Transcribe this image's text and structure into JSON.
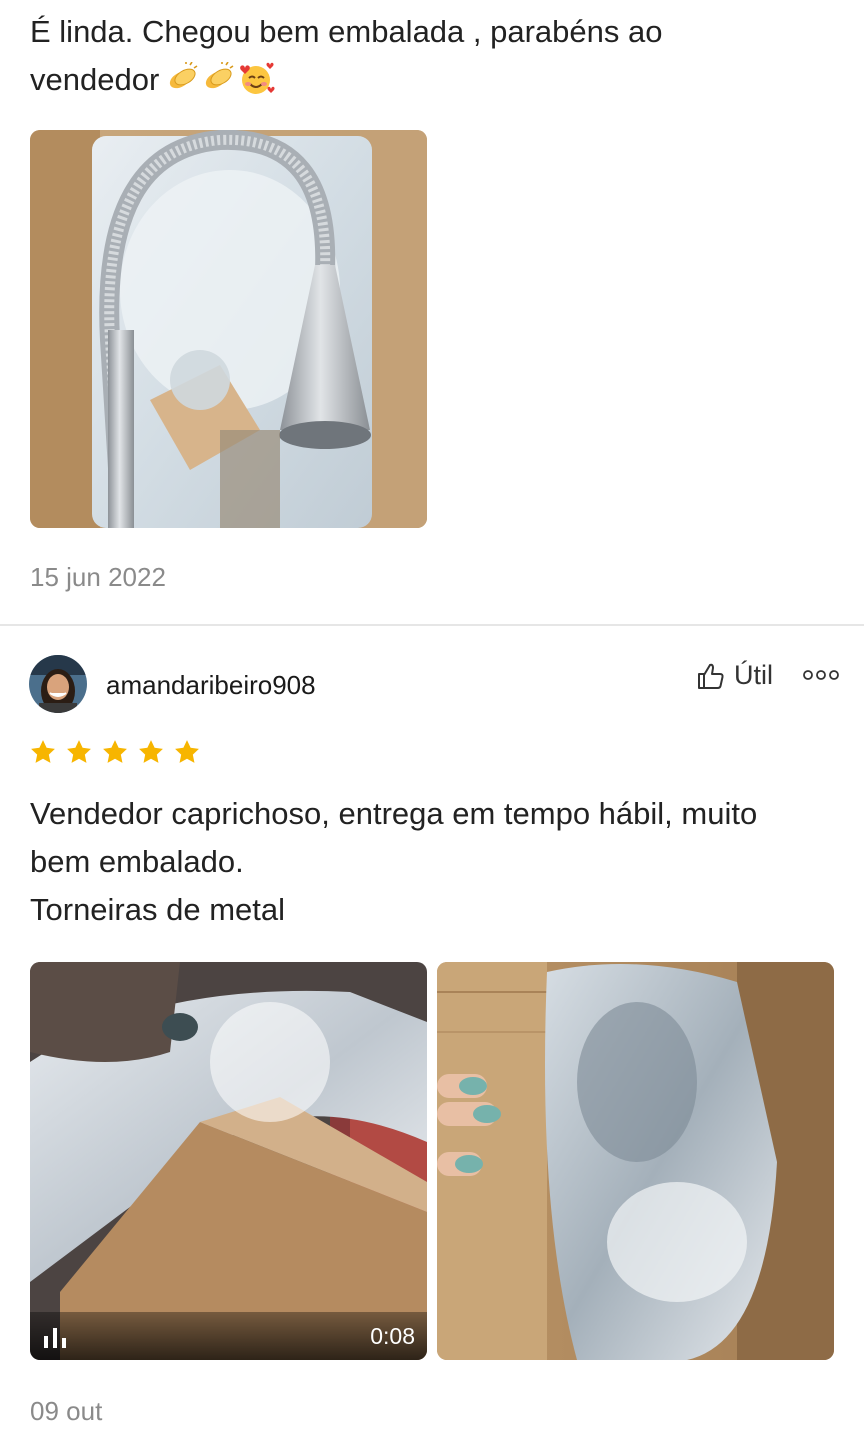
{
  "review1": {
    "text": "É linda. Chegou bem embalada , parabéns ao\nvendedor",
    "emojis": [
      "clapping-hands",
      "clapping-hands",
      "smiling-face-with-hearts"
    ],
    "date": "15 jun 2022"
  },
  "review2": {
    "username": "amandaribeiro908",
    "useful_label": "Útil",
    "rating": 5,
    "text": "Vendedor caprichoso, entrega em tempo hábil, muito\nbem embalado.\nTorneiras de metal",
    "video_duration": "0:08",
    "date": "09 out"
  },
  "colors": {
    "star": "#f7b500",
    "date": "#8a8a8a",
    "divider": "#e6e6e6"
  }
}
